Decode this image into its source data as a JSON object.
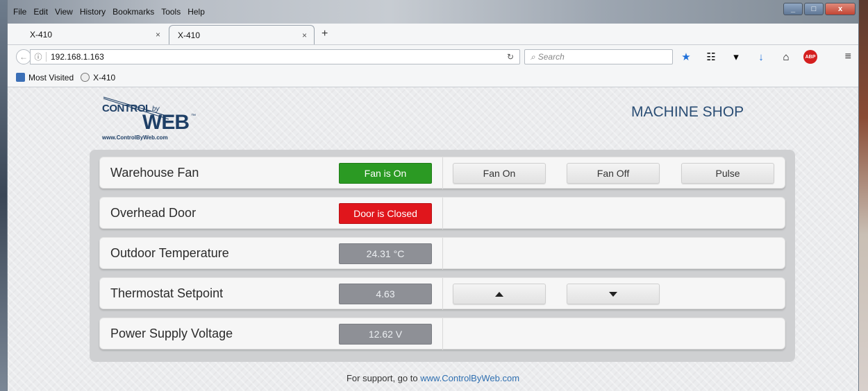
{
  "browser": {
    "menu": [
      "File",
      "Edit",
      "View",
      "History",
      "Bookmarks",
      "Tools",
      "Help"
    ],
    "tabs": [
      {
        "label": "X-410",
        "close": "×"
      },
      {
        "label": "X-410",
        "close": "×"
      }
    ],
    "new_tab": "+",
    "url": "192.168.1.163",
    "search_placeholder": "Search",
    "bookmarks": [
      {
        "label": "Most Visited"
      },
      {
        "label": "X-410"
      }
    ],
    "toolbar_icons": [
      "star-icon",
      "reading-list-icon",
      "pocket-icon",
      "download-icon",
      "home-icon",
      "adblock-icon",
      "menu-icon"
    ],
    "abp_label": "ABP"
  },
  "page": {
    "logo": {
      "control": "CONTROL",
      "by": "by",
      "web": "WEB",
      "tm": "™",
      "url": "www.ControlByWeb.com"
    },
    "title": "MACHINE SHOP",
    "rows": [
      {
        "name": "Warehouse Fan",
        "status": "Fan is On",
        "status_color": "#2b9a23",
        "buttons": [
          "Fan On",
          "Fan Off",
          "Pulse"
        ]
      },
      {
        "name": "Overhead Door",
        "status": "Door is Closed",
        "status_color": "#e0161c"
      },
      {
        "name": "Outdoor Temperature",
        "status": "24.31 °C",
        "status_color": "#8e9096"
      },
      {
        "name": "Thermostat Setpoint",
        "status": "4.63",
        "status_color": "#8e9096",
        "buttons": [
          "up-arrow-icon",
          "down-arrow-icon"
        ]
      },
      {
        "name": "Power Supply Voltage",
        "status": "12.62 V",
        "status_color": "#8e9096"
      }
    ],
    "support_text": "For support, go to",
    "support_link": "www.ControlByWeb.com"
  }
}
